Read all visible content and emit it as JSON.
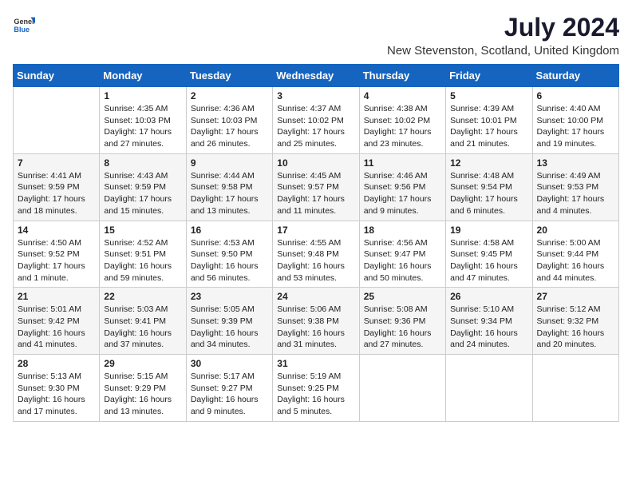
{
  "header": {
    "logo_general": "General",
    "logo_blue": "Blue",
    "month_title": "July 2024",
    "location": "New Stevenston, Scotland, United Kingdom"
  },
  "weekdays": [
    "Sunday",
    "Monday",
    "Tuesday",
    "Wednesday",
    "Thursday",
    "Friday",
    "Saturday"
  ],
  "weeks": [
    [
      {
        "day": "",
        "content": ""
      },
      {
        "day": "1",
        "content": "Sunrise: 4:35 AM\nSunset: 10:03 PM\nDaylight: 17 hours and 27 minutes."
      },
      {
        "day": "2",
        "content": "Sunrise: 4:36 AM\nSunset: 10:03 PM\nDaylight: 17 hours and 26 minutes."
      },
      {
        "day": "3",
        "content": "Sunrise: 4:37 AM\nSunset: 10:02 PM\nDaylight: 17 hours and 25 minutes."
      },
      {
        "day": "4",
        "content": "Sunrise: 4:38 AM\nSunset: 10:02 PM\nDaylight: 17 hours and 23 minutes."
      },
      {
        "day": "5",
        "content": "Sunrise: 4:39 AM\nSunset: 10:01 PM\nDaylight: 17 hours and 21 minutes."
      },
      {
        "day": "6",
        "content": "Sunrise: 4:40 AM\nSunset: 10:00 PM\nDaylight: 17 hours and 19 minutes."
      }
    ],
    [
      {
        "day": "7",
        "content": "Sunrise: 4:41 AM\nSunset: 9:59 PM\nDaylight: 17 hours and 18 minutes."
      },
      {
        "day": "8",
        "content": "Sunrise: 4:43 AM\nSunset: 9:59 PM\nDaylight: 17 hours and 15 minutes."
      },
      {
        "day": "9",
        "content": "Sunrise: 4:44 AM\nSunset: 9:58 PM\nDaylight: 17 hours and 13 minutes."
      },
      {
        "day": "10",
        "content": "Sunrise: 4:45 AM\nSunset: 9:57 PM\nDaylight: 17 hours and 11 minutes."
      },
      {
        "day": "11",
        "content": "Sunrise: 4:46 AM\nSunset: 9:56 PM\nDaylight: 17 hours and 9 minutes."
      },
      {
        "day": "12",
        "content": "Sunrise: 4:48 AM\nSunset: 9:54 PM\nDaylight: 17 hours and 6 minutes."
      },
      {
        "day": "13",
        "content": "Sunrise: 4:49 AM\nSunset: 9:53 PM\nDaylight: 17 hours and 4 minutes."
      }
    ],
    [
      {
        "day": "14",
        "content": "Sunrise: 4:50 AM\nSunset: 9:52 PM\nDaylight: 17 hours and 1 minute."
      },
      {
        "day": "15",
        "content": "Sunrise: 4:52 AM\nSunset: 9:51 PM\nDaylight: 16 hours and 59 minutes."
      },
      {
        "day": "16",
        "content": "Sunrise: 4:53 AM\nSunset: 9:50 PM\nDaylight: 16 hours and 56 minutes."
      },
      {
        "day": "17",
        "content": "Sunrise: 4:55 AM\nSunset: 9:48 PM\nDaylight: 16 hours and 53 minutes."
      },
      {
        "day": "18",
        "content": "Sunrise: 4:56 AM\nSunset: 9:47 PM\nDaylight: 16 hours and 50 minutes."
      },
      {
        "day": "19",
        "content": "Sunrise: 4:58 AM\nSunset: 9:45 PM\nDaylight: 16 hours and 47 minutes."
      },
      {
        "day": "20",
        "content": "Sunrise: 5:00 AM\nSunset: 9:44 PM\nDaylight: 16 hours and 44 minutes."
      }
    ],
    [
      {
        "day": "21",
        "content": "Sunrise: 5:01 AM\nSunset: 9:42 PM\nDaylight: 16 hours and 41 minutes."
      },
      {
        "day": "22",
        "content": "Sunrise: 5:03 AM\nSunset: 9:41 PM\nDaylight: 16 hours and 37 minutes."
      },
      {
        "day": "23",
        "content": "Sunrise: 5:05 AM\nSunset: 9:39 PM\nDaylight: 16 hours and 34 minutes."
      },
      {
        "day": "24",
        "content": "Sunrise: 5:06 AM\nSunset: 9:38 PM\nDaylight: 16 hours and 31 minutes."
      },
      {
        "day": "25",
        "content": "Sunrise: 5:08 AM\nSunset: 9:36 PM\nDaylight: 16 hours and 27 minutes."
      },
      {
        "day": "26",
        "content": "Sunrise: 5:10 AM\nSunset: 9:34 PM\nDaylight: 16 hours and 24 minutes."
      },
      {
        "day": "27",
        "content": "Sunrise: 5:12 AM\nSunset: 9:32 PM\nDaylight: 16 hours and 20 minutes."
      }
    ],
    [
      {
        "day": "28",
        "content": "Sunrise: 5:13 AM\nSunset: 9:30 PM\nDaylight: 16 hours and 17 minutes."
      },
      {
        "day": "29",
        "content": "Sunrise: 5:15 AM\nSunset: 9:29 PM\nDaylight: 16 hours and 13 minutes."
      },
      {
        "day": "30",
        "content": "Sunrise: 5:17 AM\nSunset: 9:27 PM\nDaylight: 16 hours and 9 minutes."
      },
      {
        "day": "31",
        "content": "Sunrise: 5:19 AM\nSunset: 9:25 PM\nDaylight: 16 hours and 5 minutes."
      },
      {
        "day": "",
        "content": ""
      },
      {
        "day": "",
        "content": ""
      },
      {
        "day": "",
        "content": ""
      }
    ]
  ]
}
